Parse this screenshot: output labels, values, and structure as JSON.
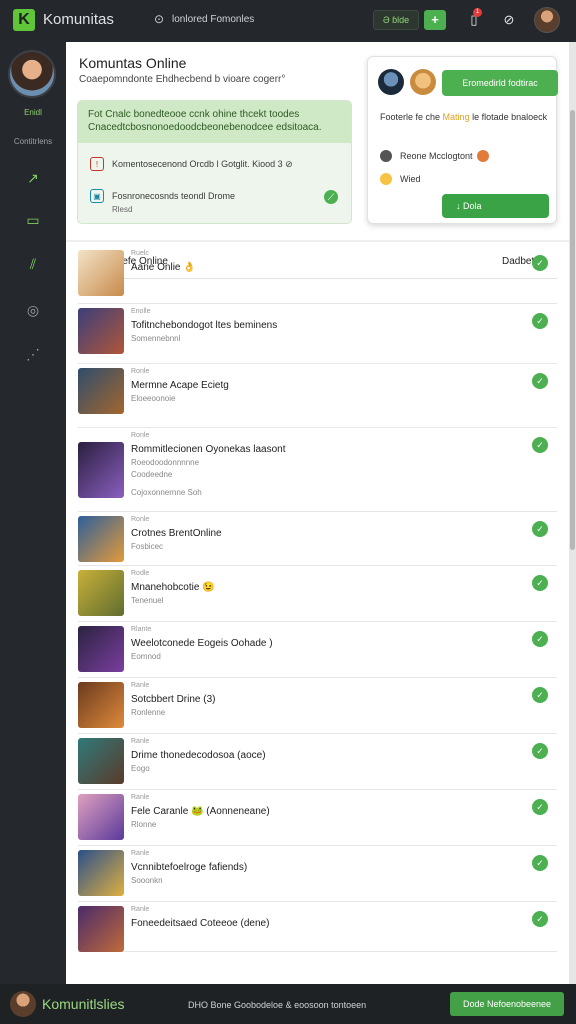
{
  "topbar": {
    "brand": "Komunitas",
    "crumb": "lonlored Fomonles",
    "ghost_btn": "Ə ɓlde",
    "plus": "+",
    "notif_count": "1"
  },
  "sidebar": {
    "user_name": "Enidl",
    "section_label": "Contitrlens",
    "icons": [
      "trend-icon",
      "chat-icon",
      "people-icon",
      "settings-icon",
      "more-icon"
    ]
  },
  "main": {
    "title": "Komuntas Online",
    "subtitle": "Coaepomndonte Ehdhecbend b vioare cogerr°",
    "info": {
      "banner": "Fot Cnalc bonedteooe ccnk ohine thcekt toodes Cnacedtcbosnonoedoodcbeonebenodcee edsitoaca.",
      "row1": "Komentosecenond Orcdb l Gotglit. Kiood 3 ⊘",
      "row1_meta": "",
      "row2": "Fosnronecosnds teondl Drome",
      "row2_meta": "Rlesd"
    },
    "friend_card": {
      "button": "Eromedirld fodtirac",
      "text_pre": "Footerle fe che ",
      "text_hl": "Mating",
      "text_post": " le flotade bnaloeck",
      "row1": "Reone Mcclogtont",
      "row2": "Wied",
      "join": "↓ Dola"
    },
    "list": {
      "title": "Dadefe Online",
      "sort": "Dadbet ≫",
      "games": [
        {
          "tag": "Ruelc",
          "title": "Aane Onlie 👌",
          "meta": ""
        },
        {
          "tag": "Enolle",
          "title": "Tofitnchebondogot ltes beminens",
          "meta": "Somennebnnl"
        },
        {
          "tag": "Ronle",
          "title": "Mermne Acape Ecietg",
          "meta": "Eloeeoonoie"
        },
        {
          "tag": "Ronle",
          "title": "Rommitlecionen Oyonekas laasont",
          "meta": "Roeodoodonnnnne",
          "meta2": "Coodeedne",
          "meta3": "Cojoxonnernne Soh"
        },
        {
          "tag": "Ronle",
          "title": "Crotnes BrentOnline",
          "meta": "Fosbicec"
        },
        {
          "tag": "Rodle",
          "title": "Mnanehobcotie 😉",
          "meta": "Tenenuel"
        },
        {
          "tag": "Rlante",
          "title": "Weelotconede Eogeis Oohade )",
          "meta": "Eomnod"
        },
        {
          "tag": "Ranle",
          "title": "Sotcbbert Drine (3)",
          "meta": "Ronlenne"
        },
        {
          "tag": "Ranle",
          "title": "Drime thonedecodosoa (aoce)",
          "meta": "Eogo"
        },
        {
          "tag": "Ranle",
          "title": "Fele Caranle  🐸 (Aonneneane)",
          "meta": "Rlonne"
        },
        {
          "tag": "Ranle",
          "title": "Vcnnibtefoelroge fafiends)",
          "meta": "Sooonkn"
        },
        {
          "tag": "Ranle",
          "title": "Foneedeitsaed Coteeoe (dene)",
          "meta": ""
        }
      ]
    }
  },
  "footer": {
    "brand": "Komunitlslies",
    "status": "DHO Bone Goobodeloe & eoosoon tontoeen",
    "button": "Dode Nefoenobeenee"
  },
  "colors": {
    "accent": "#4caf50",
    "dark_bg": "#25282c",
    "info_green": "#cfe8c6"
  }
}
